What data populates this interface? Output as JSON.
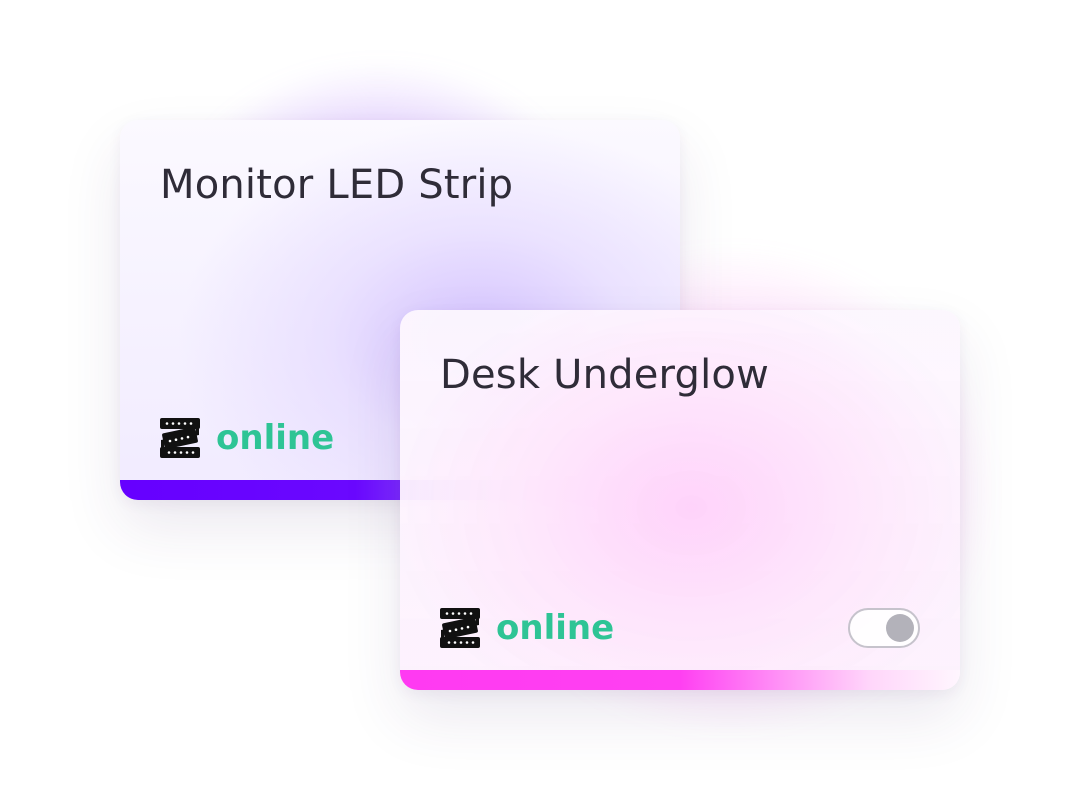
{
  "devices": [
    {
      "name": "Monitor LED Strip",
      "status": "online",
      "icon": "led-strip-icon",
      "accent_color": "#6600ff"
    },
    {
      "name": "Desk Underglow",
      "status": "online",
      "icon": "led-strip-icon",
      "accent_color": "#ff3af2",
      "power_on": false
    }
  ],
  "colors": {
    "status_online": "#2ec495",
    "title_text": "#2f2c38",
    "toggle_knob": "#b3b2ba"
  }
}
